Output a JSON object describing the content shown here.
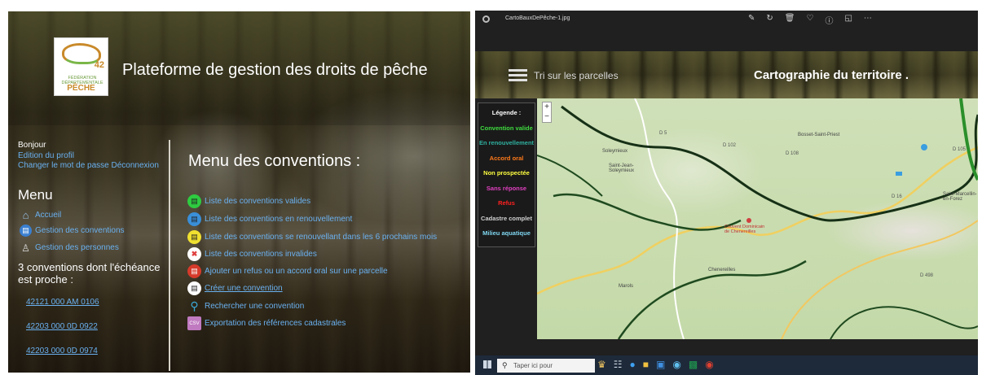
{
  "left": {
    "logo": {
      "number": "42",
      "federation": "FÉDÉRATION DÉPARTEMENTALE",
      "peche": "PÊCHE"
    },
    "site_title": "Plateforme de gestion des droits de pêche",
    "user": {
      "greeting": "Bonjour",
      "edit_profile": "Edition du profil",
      "change_password": "Changer le mot de passe",
      "logout": "Déconnexion"
    },
    "menu": {
      "heading": "Menu",
      "items": [
        {
          "label": "Accueil",
          "icon": "home-icon"
        },
        {
          "label": "Gestion des conventions",
          "icon": "document-icon"
        },
        {
          "label": "Gestion des personnes",
          "icon": "person-icon"
        }
      ]
    },
    "deadline": {
      "text": "3 conventions dont l'échéance est proche :",
      "refs": [
        "42121 000 AM 0106",
        "42203 000 0D 0922",
        "42203 000 0D 0974"
      ]
    },
    "conventions": {
      "heading": "Menu des conventions :",
      "items": [
        {
          "label": "Liste des conventions valides",
          "icon_color": "#2ecc40"
        },
        {
          "label": "Liste des conventions en renouvellement",
          "icon_color": "#3a8fd8"
        },
        {
          "label": "Liste des conventions se renouvellant dans les 6 prochains mois",
          "icon_color": "#f0e030"
        },
        {
          "label": "Liste des conventions invalides",
          "icon_color": "#e04040"
        },
        {
          "label": "Ajouter un refus ou un accord oral sur une parcelle",
          "icon_color": "#d63a2a"
        },
        {
          "label": "Créer une convention",
          "icon_color": "#ffffff"
        },
        {
          "label": "Rechercher une convention",
          "icon_color": "#3aa8d8"
        },
        {
          "label": "Exportation des références cadastrales",
          "icon_color": "#c07ac0"
        }
      ]
    }
  },
  "right": {
    "filename": "CartoBauxDePêche-1.jpg",
    "menu_label": "Tri sur les parcelles",
    "title": "Cartographie du territoire .",
    "legend": {
      "title": "Légende :",
      "items": [
        {
          "label": "Convention valide",
          "color": "#3fdc3f"
        },
        {
          "label": "En renouvellement",
          "color": "#2fb0a0"
        },
        {
          "label": "Accord oral",
          "color": "#ff7a1a"
        },
        {
          "label": "Non prospectée",
          "color": "#ffff40"
        },
        {
          "label": "Sans réponse",
          "color": "#e040c0"
        },
        {
          "label": "Refus",
          "color": "#ff2020"
        },
        {
          "label": "Cadastre complet",
          "color": "#d0d0d0"
        },
        {
          "label": "Milieu aquatique",
          "color": "#7fd6f0"
        }
      ]
    },
    "map_labels": {
      "d102": "D 102",
      "d5": "D 5",
      "d108": "D 108",
      "d105": "D 105",
      "d498": "D 498",
      "d16": "D 16",
      "bosset": "Bosset-Saint-Priest",
      "soleymieux": "Soleymieux",
      "saint_jean": "Saint-Jean-Soleymieux",
      "sury": "Sury-le-Comtal",
      "chenereilles": "Chenereilles",
      "marols": "Marols",
      "couvent": "Couvent Dominicain de Chenereilles",
      "montarcher": "Saint-Marcellin-en-Forez"
    },
    "taskbar": {
      "search_placeholder": "Taper ici pour"
    }
  }
}
